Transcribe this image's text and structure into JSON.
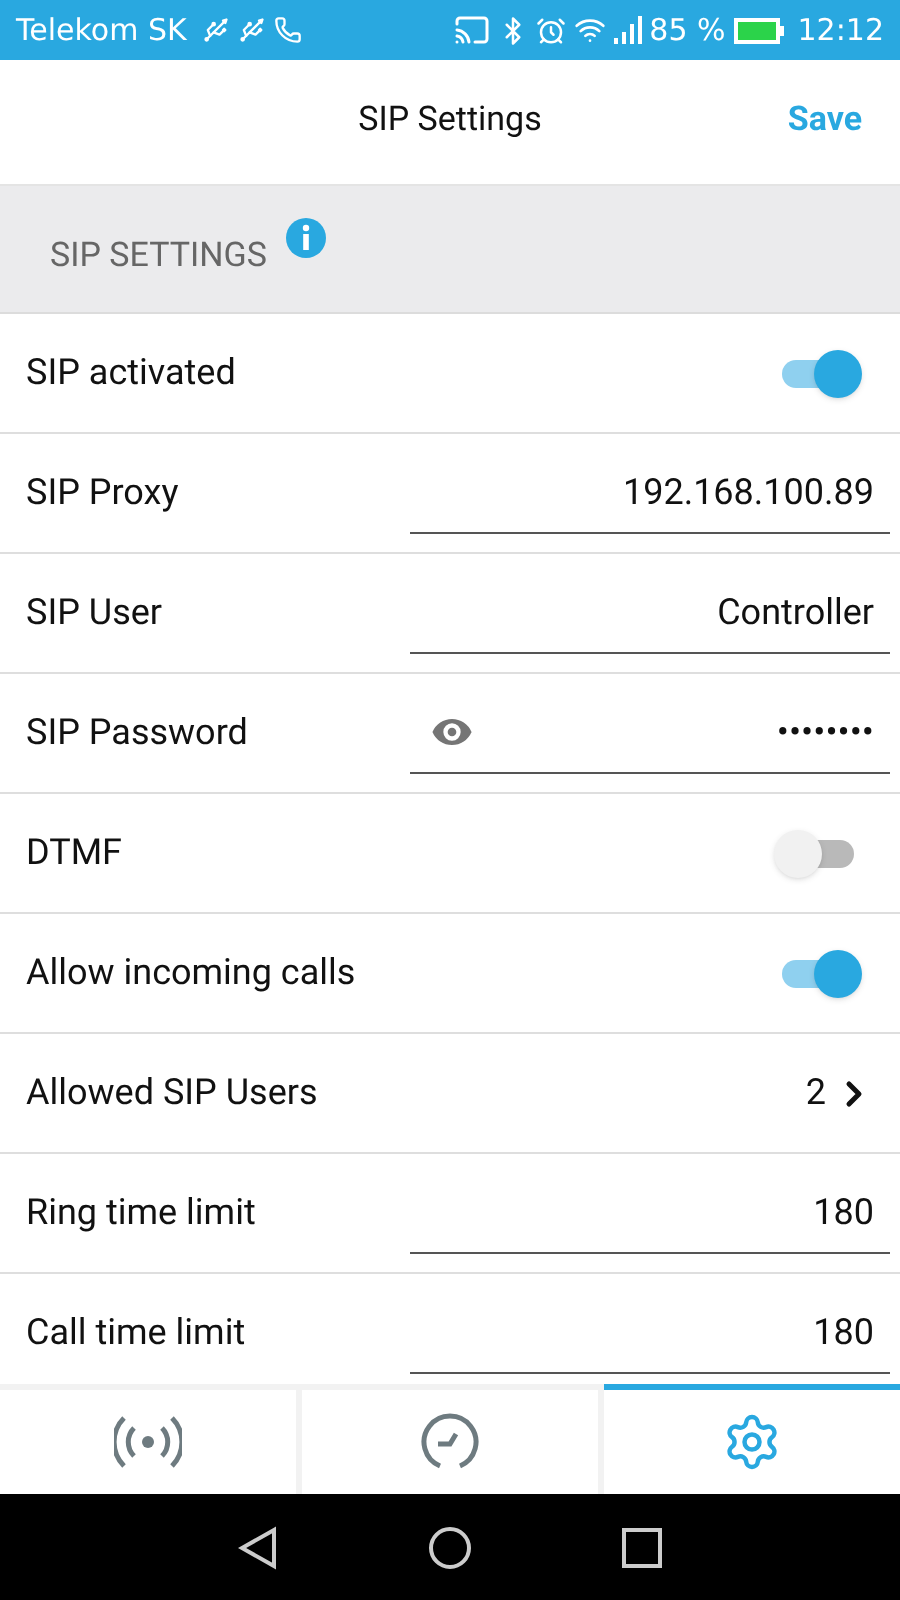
{
  "status_bar": {
    "carrier": "Telekom SK",
    "battery": "85 %",
    "time": "12:12"
  },
  "header": {
    "title": "SIP Settings",
    "action": "Save"
  },
  "section": {
    "title": "SIP SETTINGS"
  },
  "rows": [
    {
      "kind": "toggle",
      "label": "SIP activated",
      "on": true
    },
    {
      "kind": "field",
      "label": "SIP Proxy",
      "value": "192.168.100.89"
    },
    {
      "kind": "field",
      "label": "SIP User",
      "value": "Controller"
    },
    {
      "kind": "password",
      "label": "SIP Password",
      "value": "••••••••"
    },
    {
      "kind": "toggle",
      "label": "DTMF",
      "on": false
    },
    {
      "kind": "toggle",
      "label": "Allow incoming calls",
      "on": true
    },
    {
      "kind": "nav",
      "label": "Allowed SIP Users",
      "value": "2"
    },
    {
      "kind": "field",
      "label": "Ring time limit",
      "value": "180"
    },
    {
      "kind": "field",
      "label": "Call time limit",
      "value": "180"
    }
  ],
  "tabs": [
    {
      "kind": "broadcast",
      "selected": false
    },
    {
      "kind": "clock",
      "selected": false
    },
    {
      "kind": "gear",
      "selected": true
    }
  ]
}
